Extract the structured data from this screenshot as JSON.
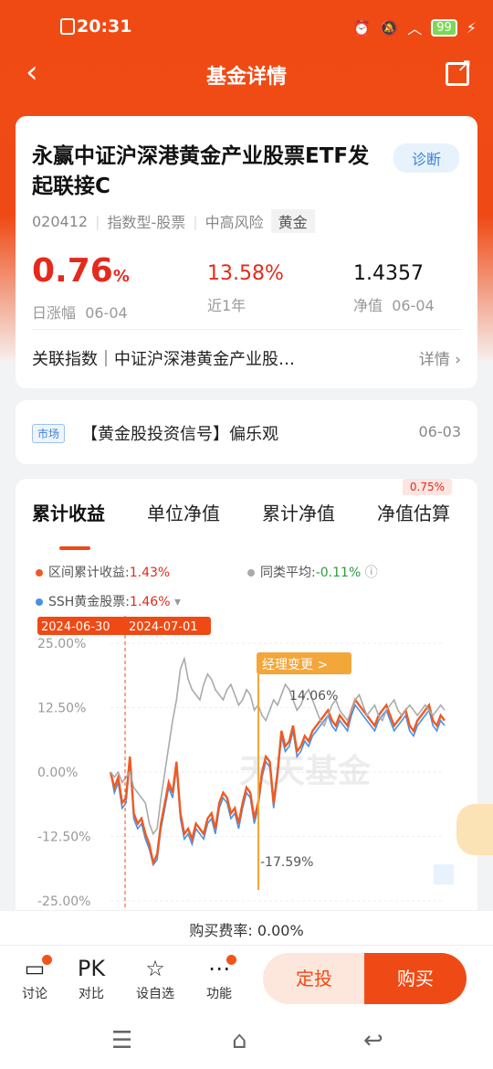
{
  "status": {
    "time": "20:31",
    "battery": "99"
  },
  "nav": {
    "title": "基金详情"
  },
  "fund": {
    "name": "永赢中证沪深港黄金产业股票ETF发起联接C",
    "diagnose": "诊断",
    "code": "020412",
    "type": "指数型-股票",
    "risk": "中高风险",
    "sector": "黄金",
    "daily_change": "0.76",
    "daily_change_unit": "%",
    "daily_label": "日涨幅",
    "daily_date": "06-04",
    "year_return": "13.58%",
    "year_label": "近1年",
    "nav_value": "1.4357",
    "nav_label": "净值",
    "nav_date": "06-04",
    "index_label": "关联指数｜中证沪深港黄金产业股…",
    "index_detail": "详情"
  },
  "news": {
    "tag": "市场",
    "title": "【黄金股投资信号】偏乐观",
    "date": "06-03"
  },
  "tabs": {
    "items": [
      "累计收益",
      "单位净值",
      "累计净值",
      "净值估算"
    ],
    "estimate_badge": "0.75%"
  },
  "legend": {
    "s1_label": "区间累计收益:",
    "s1_value": "1.43%",
    "s2_label": "同类平均:",
    "s2_value": "-0.11%",
    "s3_label": "SSH黄金股票:",
    "s3_value": "1.46%",
    "date_start": "2024-06-30",
    "date_end": "2024-07-01",
    "manager_change": "经理变更 >",
    "max_label": "14.06%",
    "min_label": "-17.59%",
    "watermark": "天天基金"
  },
  "chart_data": {
    "type": "line",
    "yticks": [
      "25.00%",
      "12.50%",
      "0.00%",
      "-12.50%",
      "-25.00%"
    ],
    "ylim": [
      -25,
      25
    ],
    "series": [
      {
        "name": "区间累计收益",
        "color": "#ef5a23",
        "values": [
          0,
          -3,
          -1,
          -6,
          -5,
          3,
          -8,
          -10,
          -9,
          -12,
          -14,
          -17.6,
          -16,
          -10,
          -6,
          -2,
          -4,
          2,
          -8,
          -12,
          -11,
          -13,
          -10,
          -11,
          -12,
          -9,
          -8,
          -11,
          -6,
          -4,
          -5,
          -8,
          -7,
          -10,
          -6,
          -3,
          -4,
          -9,
          -6,
          0,
          3,
          2,
          -6,
          0,
          8,
          5,
          6,
          9,
          4,
          5,
          7,
          6,
          8,
          9,
          10,
          11,
          12,
          10,
          9,
          11,
          10,
          9,
          12,
          14,
          13,
          12,
          11,
          10,
          9,
          11,
          12,
          13,
          11,
          9,
          10,
          11,
          12,
          9,
          8,
          10,
          11,
          12,
          13,
          10,
          9,
          11,
          10
        ]
      },
      {
        "name": "同类平均",
        "color": "#aaaaaa",
        "values": [
          0,
          -1,
          0,
          -2,
          -1,
          0,
          -3,
          -4,
          -5,
          -6,
          -10,
          -12,
          -11,
          -5,
          0,
          5,
          10,
          14,
          20,
          22,
          18,
          16,
          15,
          14,
          17,
          19,
          18,
          16,
          15,
          14,
          16,
          17,
          15,
          13,
          14,
          16,
          15,
          12,
          13,
          11,
          10,
          12,
          14,
          13,
          15,
          17,
          16,
          14,
          12,
          13,
          15,
          16,
          14,
          12,
          10,
          9,
          11,
          13,
          14,
          12,
          11,
          10,
          12,
          14,
          15,
          13,
          11,
          12,
          13,
          11,
          10,
          12,
          13,
          14,
          12,
          11,
          12,
          13,
          12,
          11,
          12,
          13,
          12,
          11,
          12,
          13,
          12
        ]
      },
      {
        "name": "SSH黄金股票",
        "color": "#4a90e2",
        "values": [
          0,
          -4,
          -2,
          -7,
          -6,
          2,
          -9,
          -11,
          -10,
          -13,
          -15,
          -18,
          -17,
          -11,
          -7,
          -3,
          -5,
          1,
          -9,
          -13,
          -12,
          -14,
          -11,
          -12,
          -13,
          -10,
          -9,
          -12,
          -7,
          -5,
          -6,
          -9,
          -8,
          -11,
          -7,
          -4,
          -5,
          -10,
          -7,
          -1,
          2,
          1,
          -7,
          -1,
          7,
          4,
          5,
          8,
          3,
          4,
          6,
          5,
          7,
          8,
          9,
          10,
          11,
          9,
          8,
          10,
          9,
          8,
          11,
          13,
          12,
          11,
          10,
          9,
          8,
          10,
          11,
          12,
          10,
          8,
          9,
          10,
          11,
          8,
          7,
          9,
          10,
          11,
          12,
          9,
          8,
          10,
          9
        ]
      }
    ]
  },
  "fee": {
    "label": "购买费率:",
    "value": "0.00%"
  },
  "bottom": {
    "discuss": "讨论",
    "pk_icon": "PK",
    "pk": "对比",
    "watch": "设自选",
    "func": "功能",
    "dingtou": "定投",
    "buy": "购买"
  }
}
